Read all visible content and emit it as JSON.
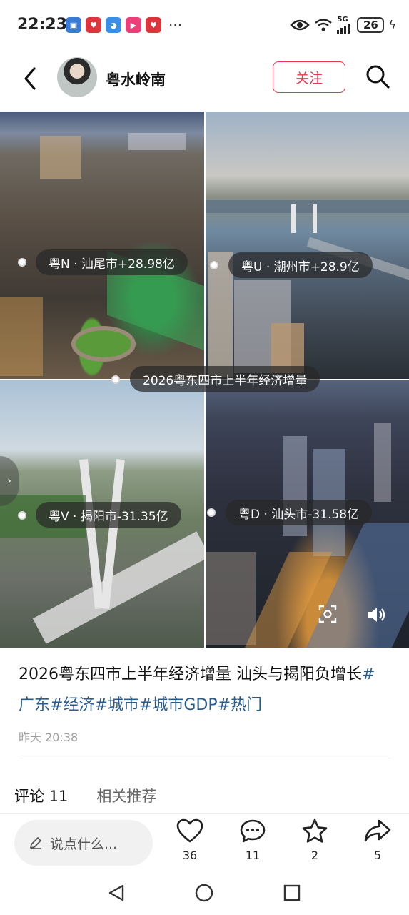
{
  "status_bar": {
    "time": "22:23",
    "network": "5G",
    "battery": "26",
    "more": "···",
    "apps": [
      {
        "icon": "app-blue-icon",
        "color": "#3a7bd5"
      },
      {
        "icon": "app-red-heart-icon",
        "color": "#e0343c"
      },
      {
        "icon": "app-blue-cat-icon",
        "color": "#3a8ee6"
      },
      {
        "icon": "app-video-play-icon",
        "color": "#ec3f7a"
      },
      {
        "icon": "app-red-heart-icon",
        "color": "#e0343c"
      }
    ]
  },
  "header": {
    "username": "粤水岭南",
    "follow_label": "关注"
  },
  "images": {
    "labels": [
      "粤N · 汕尾市+28.98亿",
      "粤U · 潮州市+28.9亿",
      "2026粤东四市上半年经济增量",
      "粤V · 揭阳市-31.35亿",
      "粤D · 汕头市-31.58亿"
    ]
  },
  "post": {
    "caption_text": "2026粤东四市上半年经济增量 汕头与揭阳负增长",
    "tags": [
      "#广东",
      "#经济",
      "#城市",
      "#城市GDP",
      "#热门"
    ],
    "time": "昨天 20:38"
  },
  "tabs": [
    {
      "label": "评论 11",
      "active": true
    },
    {
      "label": "相关推荐",
      "active": false
    }
  ],
  "action_bar": {
    "comment_placeholder": "说点什么...",
    "likes": "36",
    "comments": "11",
    "favorites": "2",
    "shares": "5"
  },
  "colors": {
    "accent": "#e5384f",
    "tag": "#2a5b8e"
  }
}
